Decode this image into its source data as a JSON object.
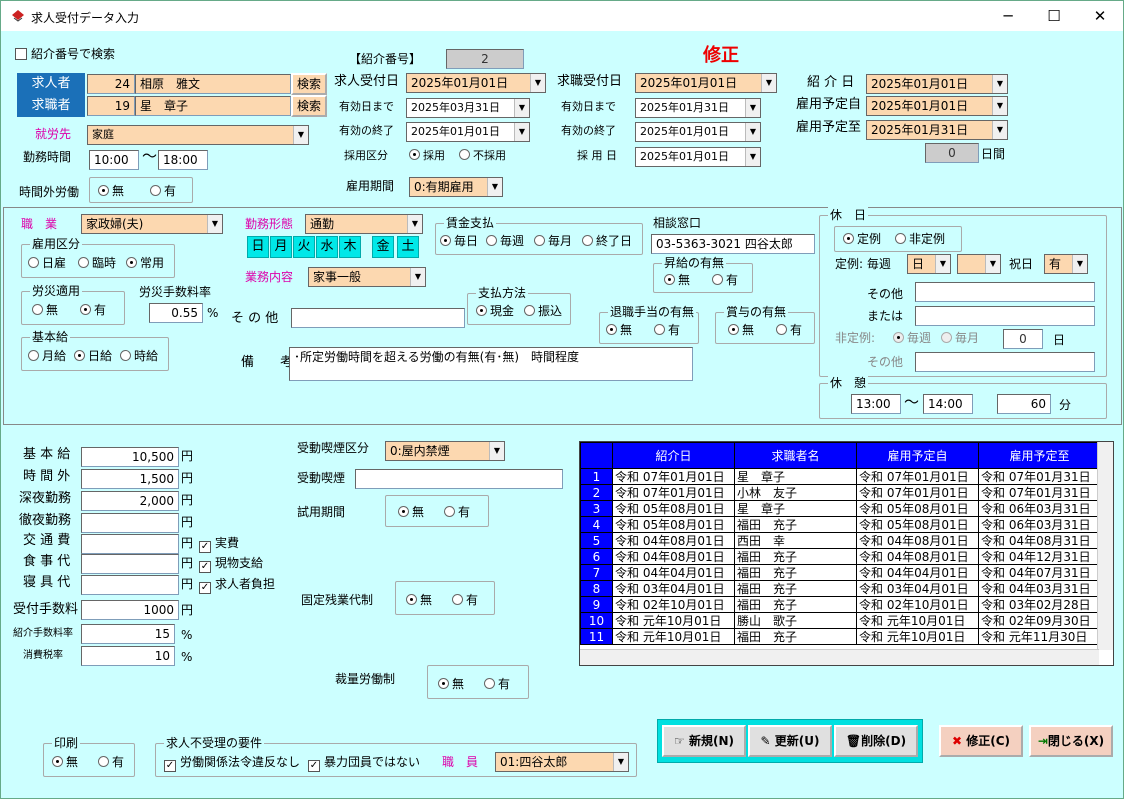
{
  "window": {
    "title": "求人受付データ入力",
    "min": "─",
    "max": "☐",
    "close": "✕"
  },
  "top": {
    "search_by_no": "紹介番号で検索",
    "intro_no_label": "【紹介番号】",
    "intro_no": "2",
    "mode": "修正"
  },
  "people": {
    "employer_label": "求人者",
    "employer_id": "24",
    "employer_name": "相原　雅文",
    "seeker_label": "求職者",
    "seeker_id": "19",
    "seeker_name": "星　章子",
    "search_btn": "検索"
  },
  "job": {
    "workplace_label": "就労先",
    "workplace": "家庭",
    "hours_label": "勤務時間",
    "start": "10:00",
    "tilde": "〜",
    "end": "18:00",
    "overtime_label": "時間外労働",
    "no": "無",
    "yes": "有"
  },
  "dates": {
    "job_reception_label": "求人受付日",
    "job_reception": "2025年01月01日",
    "valid_until_label": "有効日まで",
    "valid_until": "2025年03月31日",
    "valid_end_label": "有効の終了",
    "valid_end": "2025年01月01日",
    "seeker_reception_label": "求職受付日",
    "seeker_reception": "2025年01月01日",
    "seeker_valid_until": "2025年01月31日",
    "seeker_valid_end": "2025年01月01日",
    "hire_type_label": "採用区分",
    "hired": "採用",
    "not_hired": "不採用",
    "hire_date_label": "採 用 日",
    "hire_date": "2025年01月01日",
    "intro_date_label": "紹 介 日",
    "intro_date": "2025年01月01日",
    "emp_from_label": "雇用予定自",
    "emp_from": "2025年01月01日",
    "emp_to_label": "雇用予定至",
    "emp_to": "2025年01月31日",
    "days": "0",
    "days_unit": "日間",
    "period_label": "雇用期間",
    "period": "0:有期雇用"
  },
  "mid": {
    "occupation_label": "職　業",
    "occupation": "家政婦(夫)",
    "work_form_label": "勤務形態",
    "work_form": "通勤",
    "weekdays": [
      "日",
      "月",
      "火",
      "水",
      "木",
      "金",
      "土"
    ],
    "duties_label": "業務内容",
    "duties": "家事一般",
    "emp_type_title": "雇用区分",
    "daily": "日雇",
    "temp": "臨時",
    "regular": "常用",
    "accident_title": "労災適用",
    "accident_rate_label": "労災手数料率",
    "accident_rate": "0.55",
    "pct": "%",
    "other_label": "そ の 他",
    "base_title": "基本給",
    "monthly": "月給",
    "day": "日給",
    "hourly": "時給",
    "remarks_label": "備　　考",
    "remarks": "･所定労働時間を超える労働の有無(有･無)　時間程度",
    "wage_title": "賃金支払",
    "w_daily": "毎日",
    "w_weekly": "毎週",
    "w_monthly": "毎月",
    "w_end": "終了日",
    "consult_label": "相談窓口",
    "consult": "03-5363-3021 四谷太郎",
    "raise_title": "昇給の有無",
    "pay_title": "支払方法",
    "cash": "現金",
    "transfer": "振込",
    "retire_title": "退職手当の有無",
    "bonus_title": "賞与の有無"
  },
  "holiday": {
    "title": "休　日",
    "regular": "定例",
    "irregular": "非定例",
    "regular_label": "定例:",
    "weekly": "毎週",
    "day": "日",
    "holiday_label": "祝日",
    "holiday": "有",
    "other": "その他",
    "or": "または",
    "irregular_label": "非定例:",
    "iw": "毎週",
    "im": "毎月",
    "count": "0",
    "unit": "日",
    "other2": "その他"
  },
  "rest": {
    "title": "休　憩",
    "from": "13:00",
    "tilde": "〜",
    "to": "14:00",
    "min": "60",
    "unit": "分"
  },
  "pay": {
    "base_label": "基 本 給",
    "base": "10,500",
    "ot_label": "時 間 外",
    "ot": "1,500",
    "night_label": "深夜勤務",
    "night": "2,000",
    "allnight_label": "徹夜勤務",
    "allnight": "",
    "trans_label": "交 通 費",
    "food_label": "食 事 代",
    "sleep_label": "寝 具 代",
    "yen": "円",
    "actual": "実費",
    "inkind": "現物支給",
    "employer_pay": "求人者負担",
    "fee_label": "受付手数料",
    "fee": "1000",
    "intro_rate_label": "紹介手数料率",
    "intro_rate": "15",
    "tax_label": "消費税率",
    "tax": "10",
    "pct": "%"
  },
  "conditions": {
    "smoke_label": "受動喫煙区分",
    "smoke": "0:屋内禁煙",
    "smoke2_label": "受動喫煙",
    "trial_label": "試用期間",
    "fixed_ot_label": "固定残業代制",
    "discretion_label": "裁量労働制"
  },
  "table": {
    "headers": [
      "紹介日",
      "求職者名",
      "雇用予定自",
      "雇用予定至"
    ],
    "rows": [
      [
        "1",
        "令和 07年01月01日",
        "星　章子",
        "令和 07年01月01日",
        "令和 07年01月31日"
      ],
      [
        "2",
        "令和 07年01月01日",
        "小林　友子",
        "令和 07年01月01日",
        "令和 07年01月31日"
      ],
      [
        "3",
        "令和 05年08月01日",
        "星　章子",
        "令和 05年08月01日",
        "令和 06年03月31日"
      ],
      [
        "4",
        "令和 05年08月01日",
        "福田　充子",
        "令和 05年08月01日",
        "令和 06年03月31日"
      ],
      [
        "5",
        "令和 04年08月01日",
        "西田　幸",
        "令和 04年08月01日",
        "令和 04年08月31日"
      ],
      [
        "6",
        "令和 04年08月01日",
        "福田　充子",
        "令和 04年08月01日",
        "令和 04年12月31日"
      ],
      [
        "7",
        "令和 04年04月01日",
        "福田　充子",
        "令和 04年04月01日",
        "令和 04年07月31日"
      ],
      [
        "8",
        "令和 03年04月01日",
        "福田　充子",
        "令和 03年04月01日",
        "令和 04年03月31日"
      ],
      [
        "9",
        "令和 02年10月01日",
        "福田　充子",
        "令和 02年10月01日",
        "令和 03年02月28日"
      ],
      [
        "10",
        "令和 元年10月01日",
        "勝山　歌子",
        "令和 元年10月01日",
        "令和 02年09月30日"
      ],
      [
        "11",
        "令和 元年10月01日",
        "福田　充子",
        "令和 元年10月01日",
        "令和 元年11月30日"
      ]
    ]
  },
  "bottom": {
    "print_title": "印刷",
    "no": "無",
    "yes": "有",
    "reject_title": "求人不受理の要件",
    "labor_law": "労働関係法令違反なし",
    "gang": "暴力団員ではない",
    "staff_label": "職　員",
    "staff": "01:四谷太郎"
  },
  "buttons": {
    "new": "新規(N)",
    "update": "更新(U)",
    "delete": "削除(D)",
    "edit": "修正(C)",
    "close": "閉じる(X)"
  }
}
